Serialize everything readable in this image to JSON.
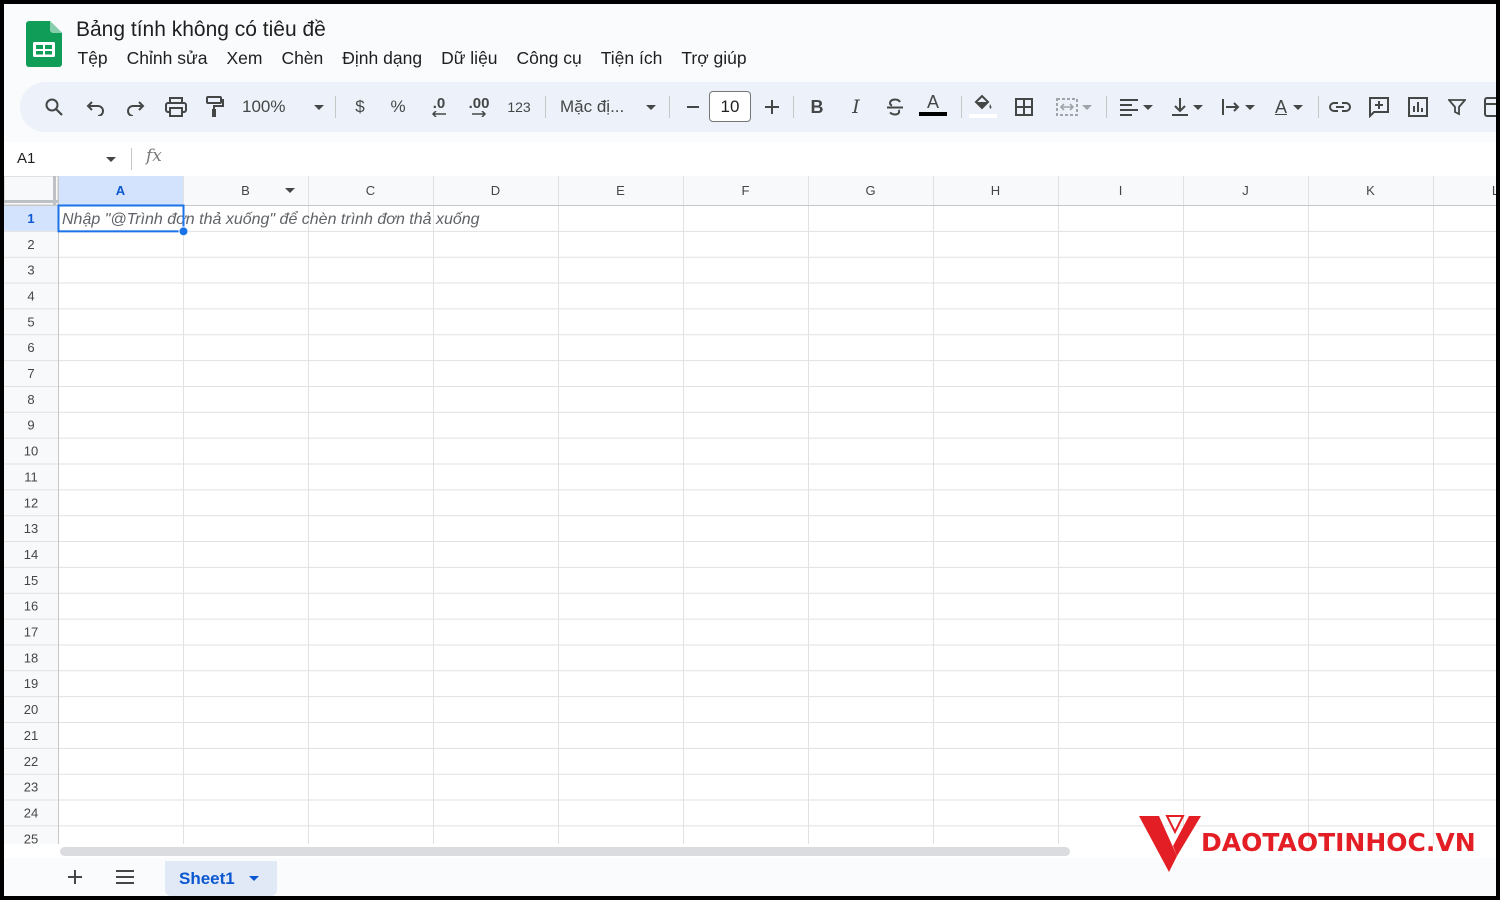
{
  "document": {
    "title": "Bảng tính không có tiêu đề"
  },
  "menu": [
    "Tệp",
    "Chỉnh sửa",
    "Xem",
    "Chèn",
    "Định dạng",
    "Dữ liệu",
    "Công cụ",
    "Tiện ích",
    "Trợ giúp"
  ],
  "toolbar": {
    "zoom": "100%",
    "currency": "$",
    "percent": "%",
    "decrease_decimal": ".0",
    "increase_decimal": ".00",
    "number_format": "123",
    "font": "Mặc đị...",
    "font_size": "10",
    "bold": "B",
    "italic": "I",
    "text_color_letter": "A",
    "text_rotation_letter": "A"
  },
  "formula_bar": {
    "name_box": "A1",
    "fx": "fx",
    "value": ""
  },
  "grid": {
    "columns": [
      "A",
      "B",
      "C",
      "D",
      "E",
      "F",
      "G",
      "H",
      "I",
      "J",
      "K",
      "L"
    ],
    "rows": [
      "1",
      "2",
      "3",
      "4",
      "5",
      "6",
      "7",
      "8",
      "9",
      "10",
      "11",
      "12",
      "13",
      "14",
      "15",
      "16",
      "17",
      "18",
      "19",
      "20",
      "21",
      "22",
      "23",
      "24",
      "25"
    ],
    "selected_cell": "A1",
    "cell_hint": "Nhập \"@Trình đơn thả xuống\" để chèn trình đơn thả xuống"
  },
  "sheets": [
    {
      "name": "Sheet1",
      "active": true
    }
  ],
  "watermark": {
    "brand": "DAOTAOTINHOC.VN"
  },
  "colors": {
    "accent": "#0b57d0",
    "selection": "#1a73e8",
    "header_selected": "#d3e3fd",
    "brand_red": "#e31e24",
    "sheets_green": "#0f9d58"
  }
}
